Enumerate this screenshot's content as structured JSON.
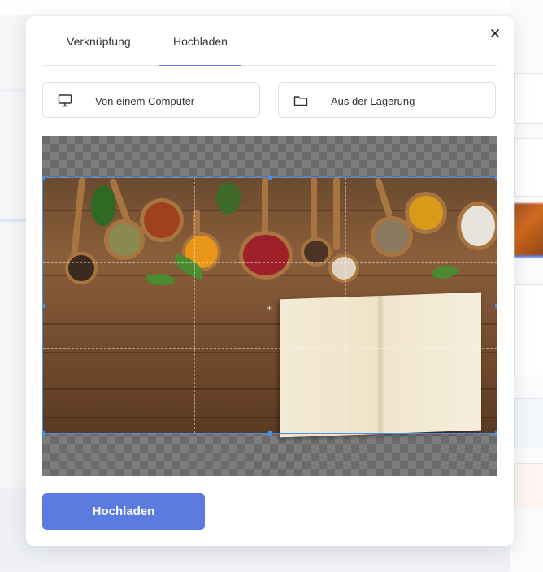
{
  "dialog": {
    "tabs": [
      {
        "label": "Verknüpfung"
      },
      {
        "label": "Hochladen"
      }
    ],
    "close_icon": "close-icon"
  },
  "sources": {
    "computer": {
      "label": "Von einem Computer",
      "icon": "monitor-icon"
    },
    "storage": {
      "label": "Aus der Lagerung",
      "icon": "folder-icon"
    }
  },
  "cropper": {
    "image_subject": "spices on wooden table with open book"
  },
  "actions": {
    "upload_label": "Hochladen"
  },
  "colors": {
    "accent": "#5b7be0",
    "crop_border": "#4a8fe8",
    "tab_active_underline": "#5a78e0"
  }
}
